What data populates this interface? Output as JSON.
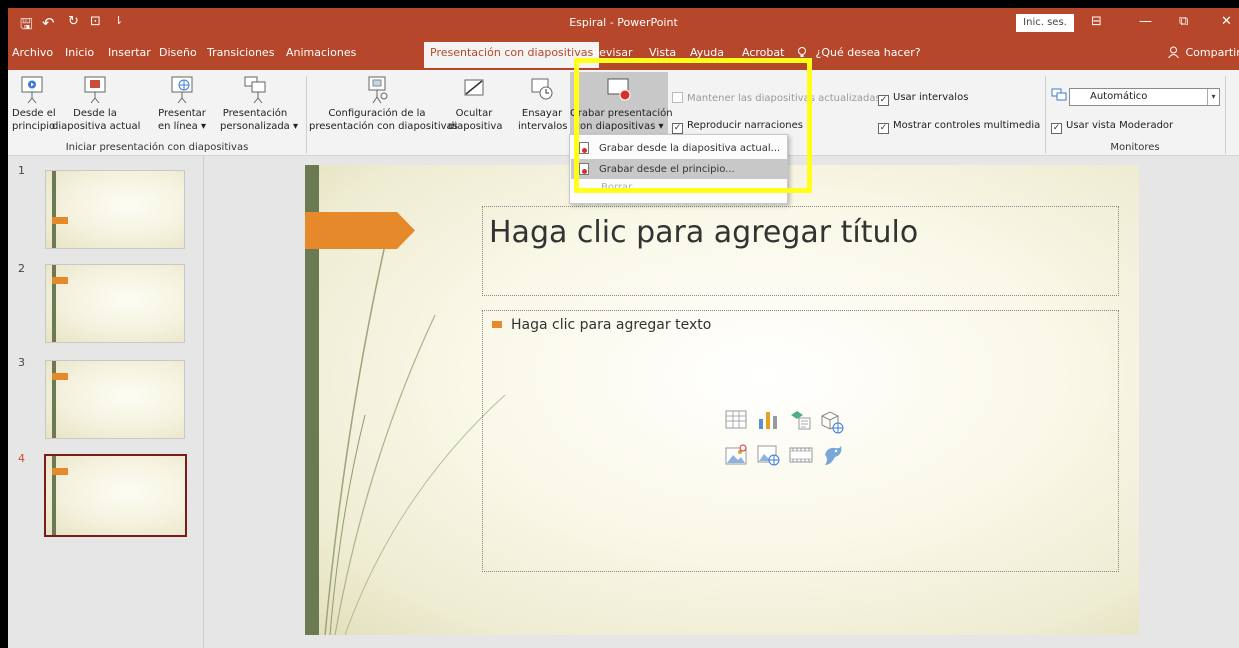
{
  "titlebar": {
    "title": "Espiral - PowerPoint",
    "signin": "Inic. ses.",
    "save_glyph": "🖫",
    "undo_glyph": "↶",
    "redo_glyph": "↻",
    "start_glyph": "⊡",
    "more_glyph": "⇂",
    "ribbon_opts_glyph": "⊟",
    "minimize_glyph": "—",
    "restore_glyph": "⧉",
    "close_glyph": "✕"
  },
  "tabs": [
    "Archivo",
    "Inicio",
    "Insertar",
    "Diseño",
    "Transiciones",
    "Animaciones",
    "Presentación con diapositivas",
    "Revisar",
    "Vista",
    "Ayuda",
    "Acrobat"
  ],
  "tell_me": "¿Qué desea hacer?",
  "share": "Compartir",
  "ribbon": {
    "btn_from_start": [
      "Desde el",
      "principio"
    ],
    "btn_from_current": [
      "Desde la",
      "diapositiva actual"
    ],
    "btn_online": [
      "Presentar",
      "en línea ▾"
    ],
    "btn_custom": [
      "Presentación",
      "personalizada ▾"
    ],
    "group_start": "Iniciar presentación con diapositivas",
    "btn_setup": [
      "Configuración de la",
      "presentación con diapositivas"
    ],
    "btn_hide": [
      "Ocultar",
      "diapositiva"
    ],
    "btn_rehearse": [
      "Ensayar",
      "intervalos"
    ],
    "btn_record": [
      "Grabar presentación",
      "con diapositivas ▾"
    ],
    "chk_keep_updated": "Mantener las diapositivas actualizadas",
    "chk_play_narrations": "Reproducir narraciones",
    "chk_use_timings": "Usar intervalos",
    "chk_media_controls": "Mostrar controles multimedia",
    "monitor_value": "Automático",
    "chk_presenter_view": "Usar vista Moderador",
    "group_monitors": "Monitores"
  },
  "dropdown": {
    "item1": "Grabar desde la diapositiva actual...",
    "item2": "Grabar desde el principio...",
    "item3": "Borrar"
  },
  "thumbnails": [
    "1",
    "2",
    "3",
    "4"
  ],
  "slide": {
    "title_placeholder": "Haga clic para agregar título",
    "body_placeholder": "Haga clic para agregar texto"
  },
  "colors": {
    "accent": "#b7472a",
    "highlight": "#ffff19",
    "slide_strip": "#6b7a52",
    "arrow": "#e6892a"
  }
}
